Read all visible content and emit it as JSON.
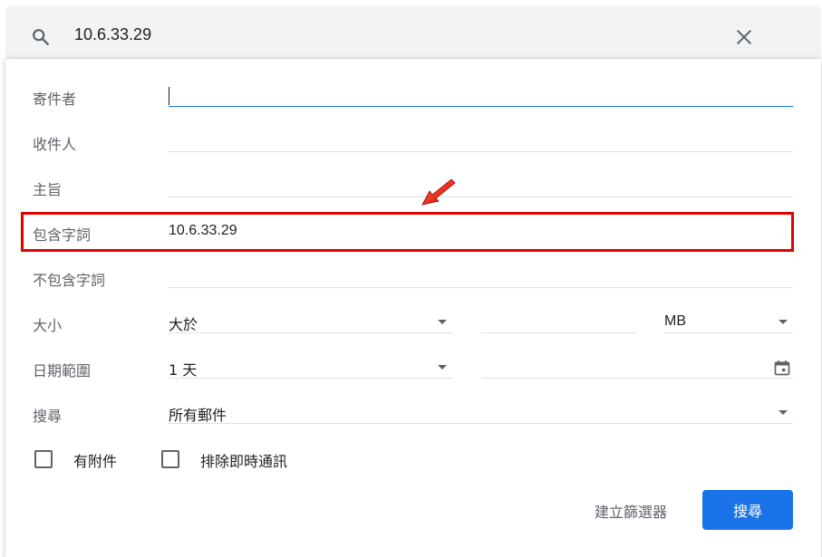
{
  "search": {
    "query": "10.6.33.29"
  },
  "form": {
    "from_label": "寄件者",
    "from_value": "",
    "to_label": "收件人",
    "to_value": "",
    "subject_label": "主旨",
    "subject_value": "",
    "has_words_label": "包含字詞",
    "has_words_value": "10.6.33.29",
    "doesnt_have_label": "不包含字詞",
    "doesnt_have_value": "",
    "size_label": "大小",
    "size_operator": "大於",
    "size_value": "",
    "size_unit": "MB",
    "date_label": "日期範圍",
    "date_range": "1 天",
    "date_value": "",
    "search_in_label": "搜尋",
    "search_in_value": "所有郵件",
    "has_attachment_label": "有附件",
    "exclude_chats_label": "排除即時通訊"
  },
  "buttons": {
    "create_filter": "建立篩選器",
    "search": "搜尋"
  },
  "colors": {
    "accent": "#1a73e8",
    "highlight": "#e00000"
  }
}
